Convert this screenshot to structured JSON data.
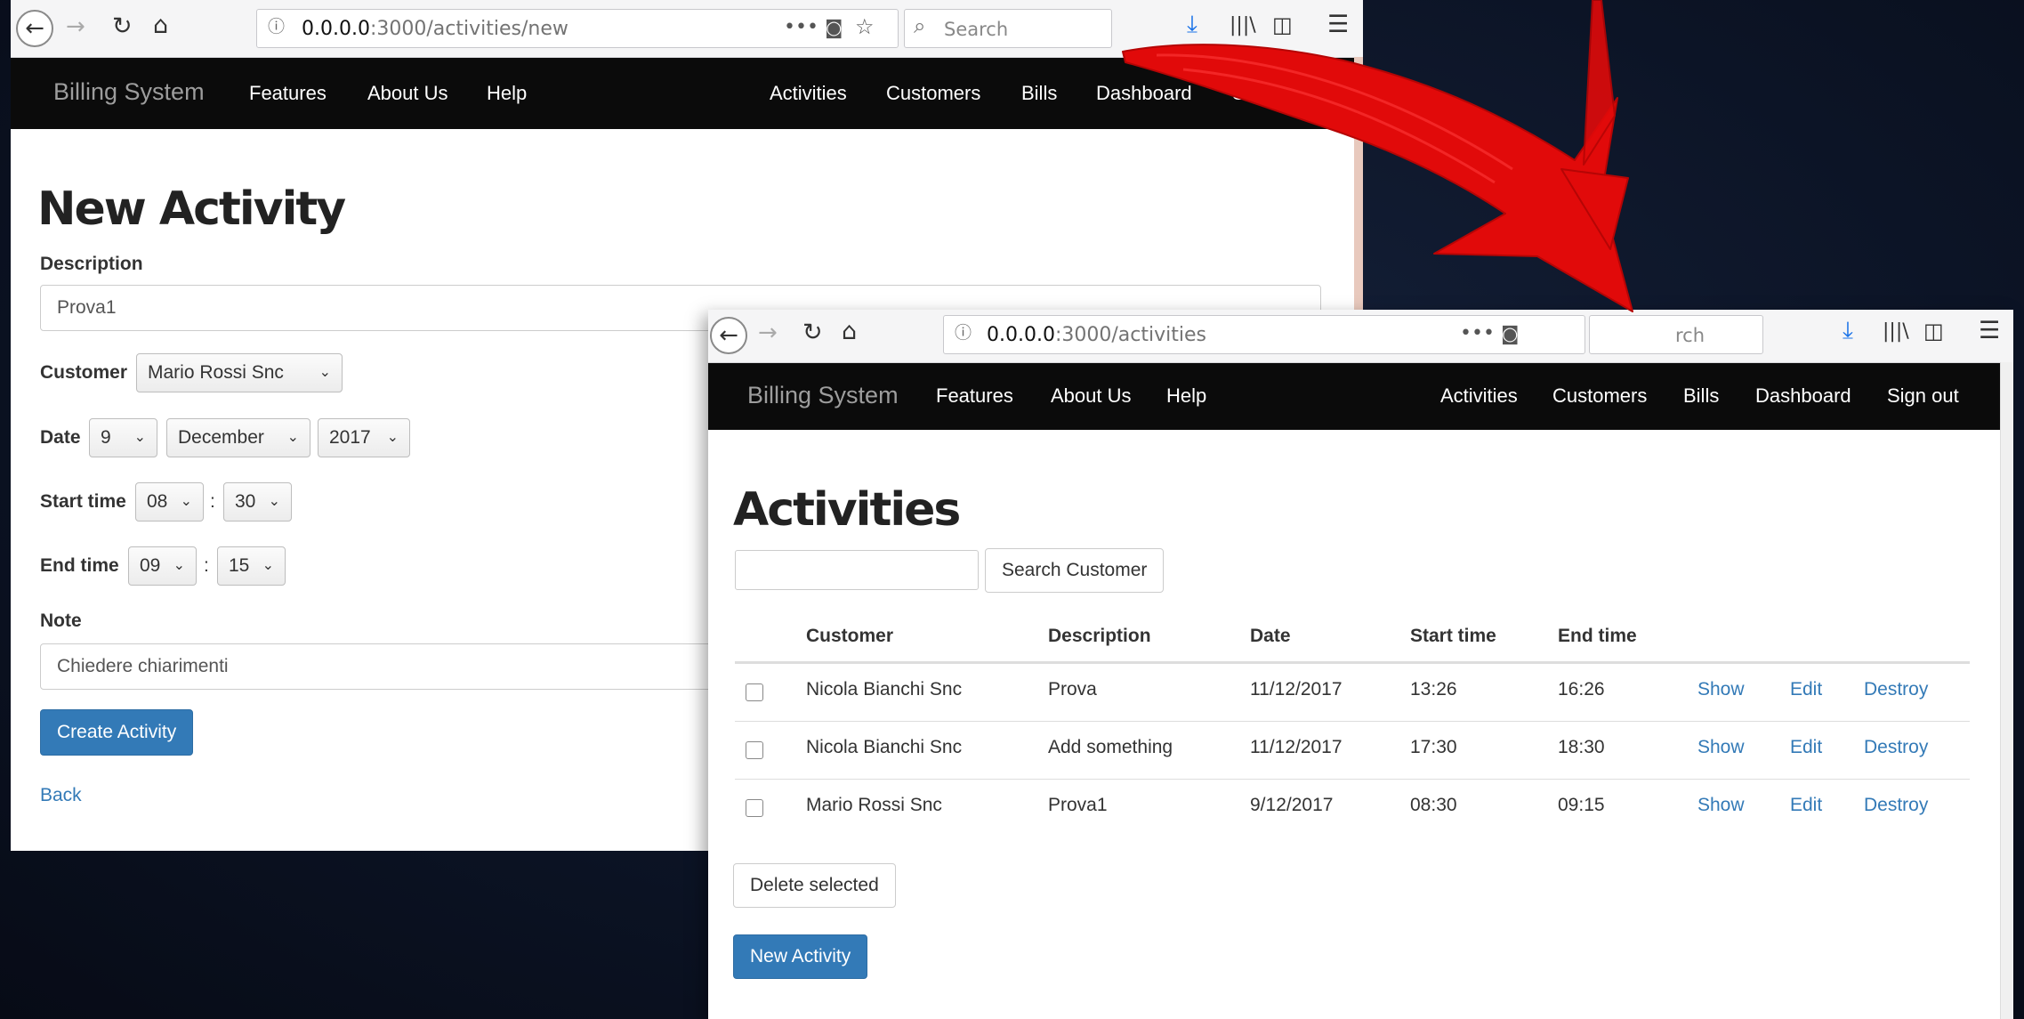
{
  "window_new": {
    "url_host": "0.0.0.0",
    "url_path": ":3000/activities/new",
    "search_placeholder": "Search",
    "brand": "Billing System",
    "nav_left": [
      "Features",
      "About Us",
      "Help"
    ],
    "nav_right": [
      "Activities",
      "Customers",
      "Bills",
      "Dashboard",
      "Sign out"
    ],
    "title": "New Activity",
    "description_label": "Description",
    "description_value": "Prova1",
    "customer_label": "Customer",
    "customer_value": "Mario Rossi Snc",
    "date_label": "Date",
    "date_day": "9",
    "date_month": "December",
    "date_year": "2017",
    "start_label": "Start time",
    "start_hour": "08",
    "start_minute": "30",
    "end_label": "End time",
    "end_hour": "09",
    "end_minute": "15",
    "time_separator": ":",
    "note_label": "Note",
    "note_value": "Chiedere chiarimenti",
    "create_button": "Create Activity",
    "back_link": "Back"
  },
  "window_list": {
    "url_host": "0.0.0.0",
    "url_path": ":3000/activities",
    "search_placeholder_partial": "rch",
    "brand": "Billing System",
    "nav_left": [
      "Features",
      "About Us",
      "Help"
    ],
    "nav_right": [
      "Activities",
      "Customers",
      "Bills",
      "Dashboard",
      "Sign out"
    ],
    "title": "Activities",
    "search_customer_button": "Search Customer",
    "columns": [
      "Customer",
      "Description",
      "Date",
      "Start time",
      "End time"
    ],
    "rows": [
      {
        "customer": "Nicola Bianchi Snc",
        "description": "Prova",
        "date": "11/12/2017",
        "start": "13:26",
        "end": "16:26"
      },
      {
        "customer": "Nicola Bianchi Snc",
        "description": "Add something",
        "date": "11/12/2017",
        "start": "17:30",
        "end": "18:30"
      },
      {
        "customer": "Mario Rossi Snc",
        "description": "Prova1",
        "date": "9/12/2017",
        "start": "08:30",
        "end": "09:15"
      }
    ],
    "row_actions": [
      "Show",
      "Edit",
      "Destroy"
    ],
    "delete_selected_button": "Delete selected",
    "new_activity_button": "New Activity"
  },
  "colors": {
    "navbar": "#0b0b0b",
    "primary": "#337ab7",
    "arrow": "#e10a0a",
    "download_icon": "#1a73e8"
  },
  "icons": [
    "back-icon",
    "forward-icon",
    "reload-icon",
    "home-icon",
    "info-icon",
    "more-icon",
    "pocket-icon",
    "star-icon",
    "search-icon",
    "download-icon",
    "library-icon",
    "sidebar-icon",
    "menu-icon",
    "chevron-down-icon",
    "red-arrow-annotation"
  ]
}
